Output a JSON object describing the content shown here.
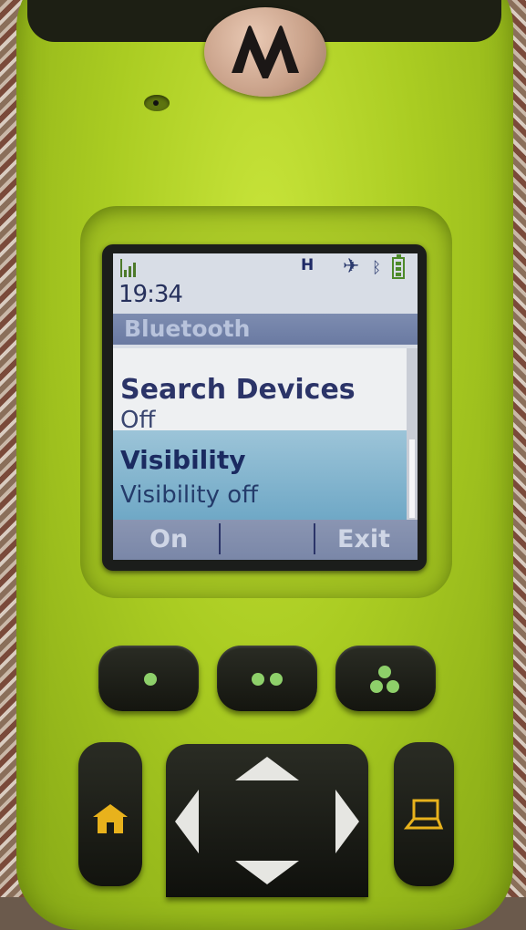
{
  "device": {
    "brand_logo": "motorola-logo",
    "colors": {
      "body": "#aacc22",
      "keys": "#1a1c15",
      "led_dot": "#8ed06a",
      "key_icon": "#e8b21c"
    }
  },
  "status_bar": {
    "signal_icon": "signal-bars-icon",
    "network_indicator": "H",
    "gps_icon": "gps-satellite-icon",
    "bluetooth_icon": "bluetooth-icon",
    "battery_icon": "battery-icon",
    "time": "19:34"
  },
  "screen": {
    "title": "Bluetooth",
    "items": [
      {
        "label": "Search Devices",
        "value": "Off"
      },
      {
        "label": "Visibility",
        "value": "Visibility off"
      }
    ],
    "softkeys": {
      "left": "On",
      "middle": "",
      "right": "Exit"
    }
  },
  "keys": {
    "function_keys": [
      "one-dot-key",
      "two-dot-key",
      "three-dot-key"
    ],
    "home_icon": "home-icon",
    "menu_icon": "laptop-icon",
    "nav_arrows": [
      "up-arrow-icon",
      "down-arrow-icon",
      "left-arrow-icon",
      "right-arrow-icon"
    ]
  }
}
